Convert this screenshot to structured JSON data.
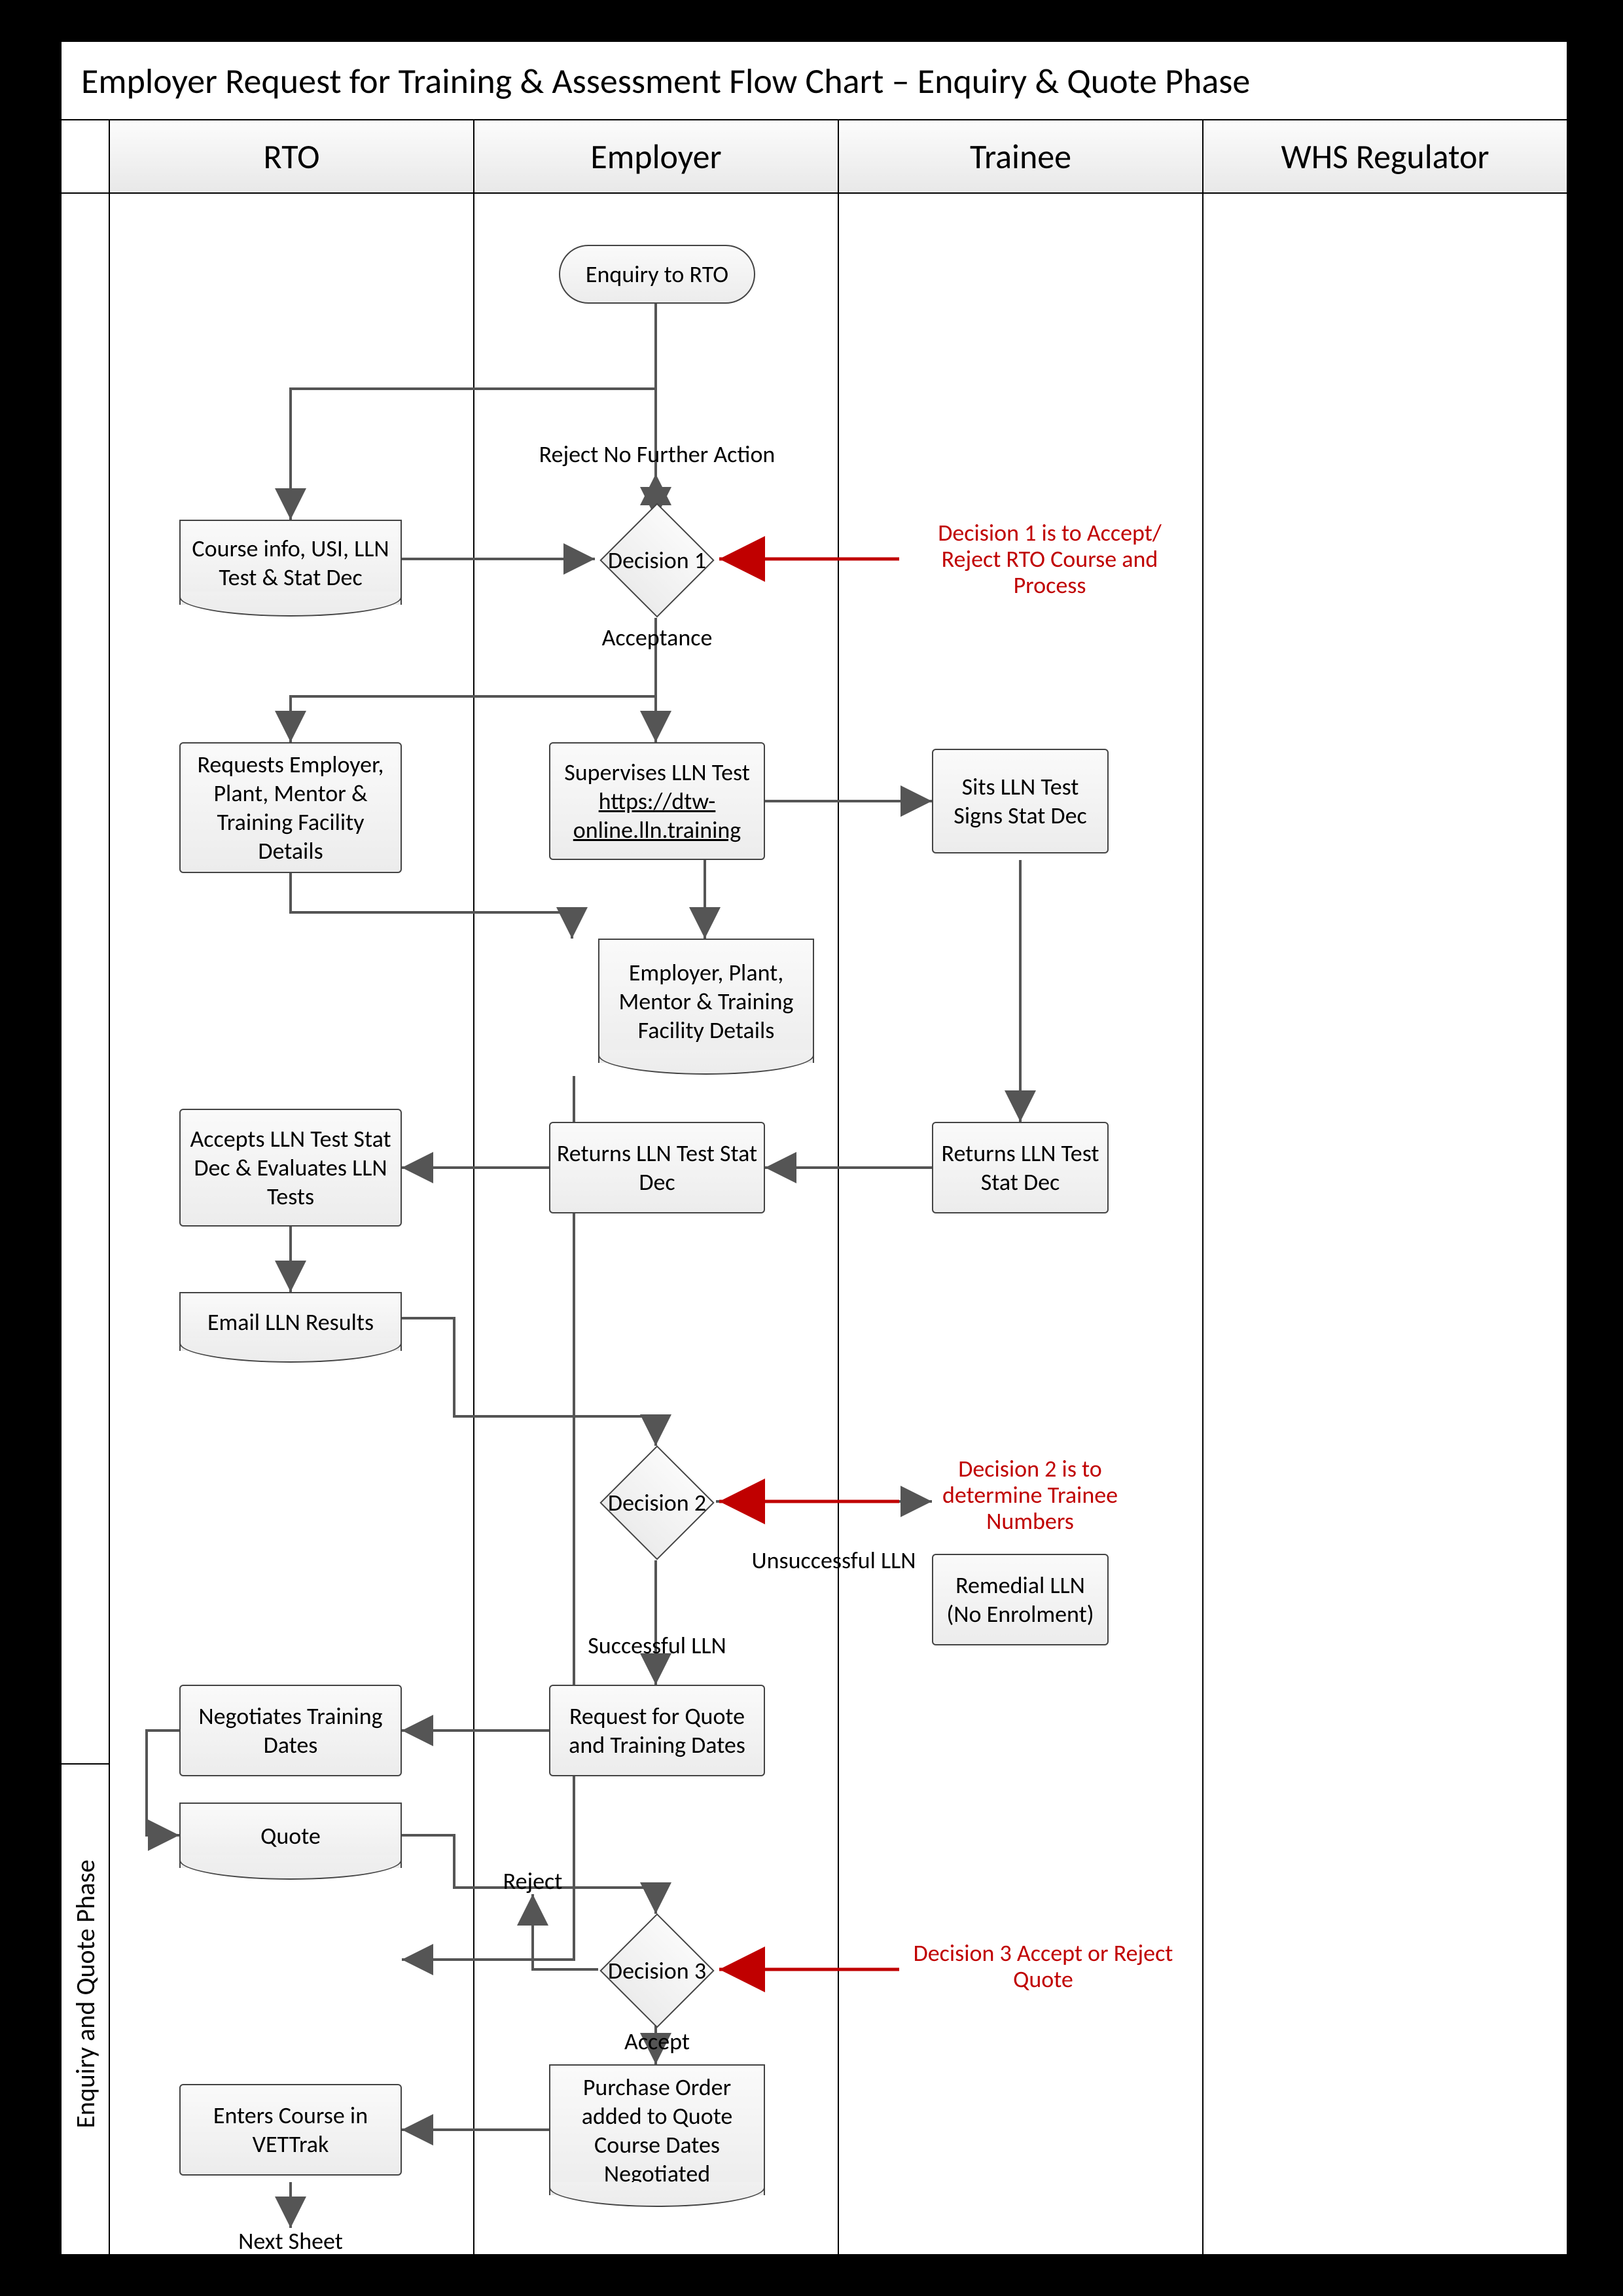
{
  "title": "Employer Request for Training & Assessment Flow Chart – Enquiry & Quote Phase",
  "lanes": {
    "a": "RTO",
    "b": "Employer",
    "c": "Trainee",
    "d": "WHS Regulator"
  },
  "side": "Enquiry and Quote Phase",
  "n": {
    "enq": "Enquiry to RTO",
    "cinfo": "Course info, USI, LLN Test & Stat Dec",
    "d1": "Decision 1",
    "reqdet": "Requests Employer, Plant, Mentor & Training Facility Details",
    "supl1": "Supervises LLN Test",
    "supl2": "https://dtw-online.lln.training",
    "sits": "Sits LLN Test Signs Stat Dec",
    "epmtd": "Employer, Plant, Mentor & Training Facility Details",
    "retE": "Returns LLN Test Stat Dec",
    "retT": "Returns LLN Test Stat Dec",
    "accE": "Accepts LLN Test Stat Dec & Evaluates LLN Tests",
    "email": "Email LLN Results",
    "d2": "Decision 2",
    "rem": "Remedial LLN (No Enrolment)",
    "rfq": "Request for Quote and Training Dates",
    "neg": "Negotiates Training Dates",
    "quote": "Quote",
    "d3": "Decision 3",
    "po": "Purchase Order added to Quote Course Dates Negotiated",
    "vet": "Enters Course in VETTrak",
    "next": "Next Sheet"
  },
  "l": {
    "rej": "Reject No Further Action",
    "acc": "Acceptance",
    "unslln": "Unsuccessful LLN",
    "sclln": "Successful LLN",
    "rej2": "Reject",
    "acc2": "Accept",
    "a1": "Decision 1 is to Accept/ Reject RTO Course and Process",
    "a2": "Decision 2 is to determine Trainee Numbers",
    "a3": "Decision 3 Accept or Reject Quote"
  }
}
